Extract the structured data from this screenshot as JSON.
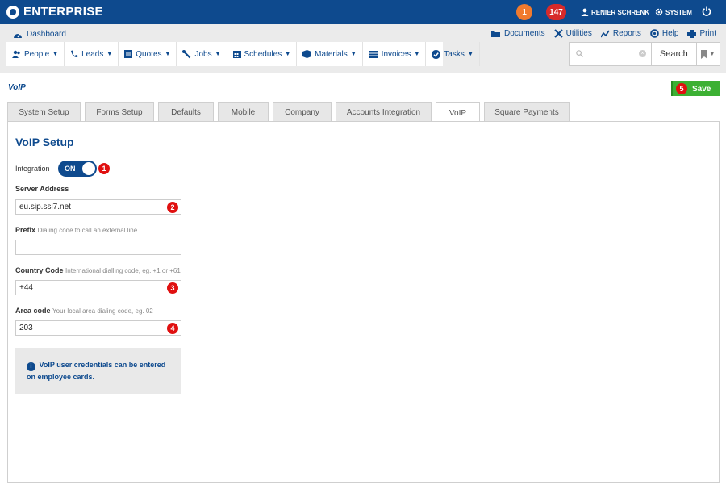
{
  "topbar": {
    "brand": "ENTERPRISE",
    "badge_orange": "1",
    "badge_red": "147",
    "user": "RENIER SCHRENK",
    "system": "SYSTEM"
  },
  "nav": {
    "dashboard": "Dashboard",
    "utilities": [
      {
        "label": "Documents",
        "icon": "folder-icon"
      },
      {
        "label": "Utilities",
        "icon": "tools-icon"
      },
      {
        "label": "Reports",
        "icon": "chart-icon"
      },
      {
        "label": "Help",
        "icon": "lifebuoy-icon"
      },
      {
        "label": "Print",
        "icon": "printer-icon"
      }
    ],
    "menu": [
      {
        "label": "People"
      },
      {
        "label": "Leads"
      },
      {
        "label": "Quotes"
      },
      {
        "label": "Jobs"
      },
      {
        "label": "Schedules"
      },
      {
        "label": "Materials"
      },
      {
        "label": "Invoices"
      },
      {
        "label": "Tasks"
      }
    ],
    "search_placeholder": "",
    "search_button": "Search"
  },
  "page": {
    "title": "VoIP",
    "save_label": "Save",
    "save_step": "5"
  },
  "tabs": [
    {
      "label": "System Setup",
      "active": false
    },
    {
      "label": "Forms Setup",
      "active": false
    },
    {
      "label": "Defaults",
      "active": false
    },
    {
      "label": "Mobile",
      "active": false
    },
    {
      "label": "Company",
      "active": false
    },
    {
      "label": "Accounts Integration",
      "active": false
    },
    {
      "label": "VoIP",
      "active": true
    },
    {
      "label": "Square Payments",
      "active": false
    }
  ],
  "form": {
    "title": "VoIP Setup",
    "integration_label": "Integration",
    "integration_state": "ON",
    "integration_step": "1",
    "server_label": "Server Address",
    "server_value": "eu.sip.ssl7.net",
    "server_step": "2",
    "prefix_label": "Prefix",
    "prefix_hint": "Dialing code to call an external line",
    "prefix_value": "",
    "country_label": "Country Code",
    "country_hint": "International dialling code, eg. +1 or +61",
    "country_value": "+44",
    "country_step": "3",
    "area_label": "Area code",
    "area_hint": "Your local area dialing code, eg. 02",
    "area_value": "203",
    "area_step": "4",
    "info_text": "VoIP user credentials can be entered on employee cards."
  },
  "colors": {
    "brand_blue": "#0e4a8e",
    "save_green": "#3cb033",
    "step_red": "#e01010",
    "badge_orange": "#f07a2e",
    "badge_red": "#d72a2a"
  }
}
